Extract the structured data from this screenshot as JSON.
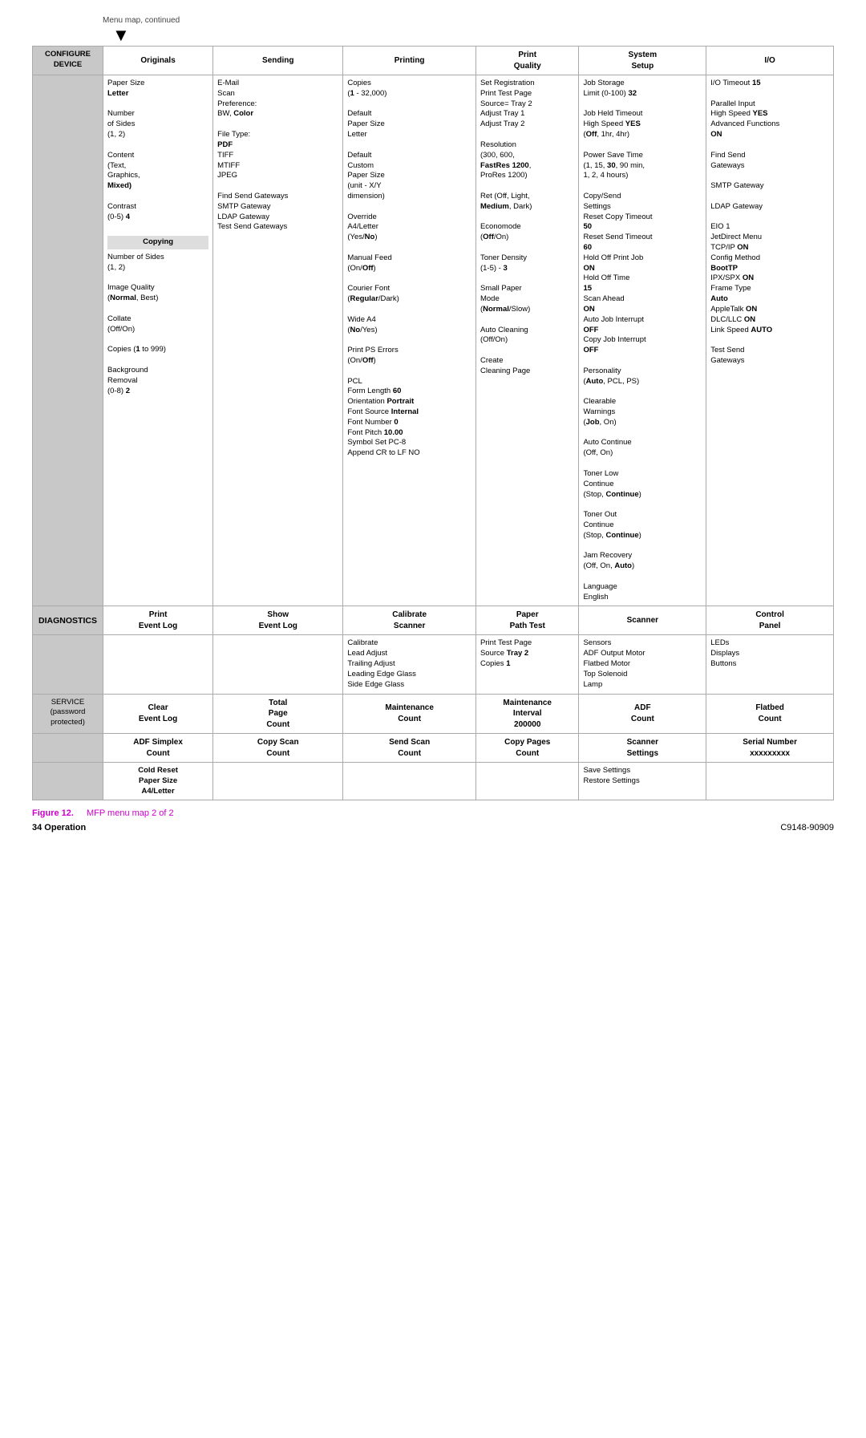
{
  "page": {
    "menu_continued": "Menu map, continued",
    "figure_label": "Figure 12.",
    "figure_title": "MFP menu map 2 of 2",
    "footer_left": "34  Operation",
    "footer_right": "C9148-90909"
  },
  "configure_device": {
    "label": "CONFIGURE\nDEVICE",
    "columns": {
      "originals": {
        "header": "Originals",
        "content_normal": [
          "Paper Size",
          "Number of Sides (1, 2)",
          "Content (Text, Graphics,",
          "Contrast (0-5)"
        ],
        "content_bold": [
          "Letter",
          "Mixed)",
          "4"
        ],
        "copying_header": "Copying",
        "copying_items": [
          "Number of Sides (1, 2)",
          "Image Quality",
          "Collate (Off/On)",
          "Copies",
          "Background Removal (0-8)"
        ],
        "copying_bold": [
          "(Normal, Best)",
          "1 to 999)",
          "2"
        ]
      },
      "sending": {
        "header": "Sending",
        "items": [
          "E-Mail Scan Preference: BW,",
          "File Type: PDF TIFF MTIFF JPEG",
          "Find Send Gateways SMTP Gateway LDAP Gateway Test Send Gateways"
        ],
        "bold_items": [
          "Color"
        ]
      },
      "printing": {
        "header": "Printing",
        "items": [
          "Copies (1 - 32,000)",
          "Print Test Page",
          "Source= Tray 2",
          "Adjust Tray 1",
          "Adjust Tray 2",
          "Default Paper Size Letter",
          "Default Custom Paper Size (unit - X/Y dimension)",
          "Override A4/Letter (Yes/No)",
          "Manual Feed (On/Off)",
          "Courier Font (Regular/Dark)",
          "Wide A4 (No/Yes)",
          "Print PS Errors (On/Off)",
          "PCL Form Length 60 Orientation Portrait Font Source Internal Font Number 0 Font Pitch 10.00 Symbol Set PC-8 Append CR to LF NO"
        ]
      },
      "print_quality": {
        "header": "Print\nQuality",
        "items": [
          "Set Registration Print Test Page Source= Tray 2 Adjust Tray 1 Adjust Tray 2",
          "Resolution (300, 600, FastRes 1200, ProRes 1200)",
          "Ret (Off, Light, Medium, Dark)",
          "Economode (Off/On)",
          "Toner Density (1-5) - 3",
          "Small Paper Mode (Normal/Slow)",
          "Auto Cleaning (Off/On)",
          "Create Cleaning Page"
        ]
      },
      "system_setup": {
        "header": "System\nSetup",
        "items": [
          "Job Storage Limit (0-100) 32",
          "Job Held Timeout (Off, 1hr, 4hr)",
          "Power Save Time (1, 15, 30, 90 min, 1, 2, 4 hours)",
          "Copy/Send Settings Reset Copy Timeout 50 Reset Send Timeout 60 Hold Off Print Job ON Hold Off Time 15 Scan Ahead ON Auto Job Interrupt OFF Copy Job Interrupt OFF",
          "Personality (Auto, PCL, PS)",
          "Clearable Warnings (Job, On)",
          "Auto Continue (Off, On)",
          "Toner Low Continue (Stop, Continue)",
          "Toner Out Continue (Stop, Continue)",
          "Jam Recovery (Off, On, Auto)",
          "Language English"
        ]
      },
      "io": {
        "header": "I/O",
        "items": [
          "I/O Timeout 15",
          "Parallel Input High Speed YES Advanced Functions ON",
          "Find Send Gateways",
          "SMTP Gateway",
          "LDAP Gateway",
          "EIO 1 JetDirect Menu TCP/IP ON Config Method BootTP IPX/SPX ON Frame Type Auto AppleTalk ON DLC/LLC ON Link Speed AUTO",
          "Test Send Gateways"
        ]
      }
    }
  },
  "diagnostics": {
    "label": "DIAGNOSTICS",
    "columns": {
      "print_event_log": {
        "header": "Print\nEvent Log"
      },
      "show_event_log": {
        "header": "Show\nEvent Log"
      },
      "calibrate_scanner": {
        "header": "Calibrate\nScanner",
        "items": [
          "Calibrate Lead Adjust Trailing Adjust Leading Edge Glass Side Edge Glass"
        ]
      },
      "paper_path_test": {
        "header": "Paper\nPath Test",
        "items": [
          "Print Test Page",
          "Source Tray 2",
          "Copies 1"
        ],
        "bold": [
          "Tray 2"
        ]
      },
      "scanner": {
        "header": "Scanner",
        "items": [
          "Sensors ADF Output Motor Flatbed Motor Top Solenoid Lamp"
        ]
      },
      "control_panel": {
        "header": "Control\nPanel",
        "items": [
          "LEDs Displays Buttons"
        ]
      }
    }
  },
  "service": {
    "label": "SERVICE\n(password\nprotected)",
    "row1": {
      "clear_event_log": "Clear\nEvent Log",
      "total_page_count": "Total\nPage\nCount",
      "maintenance_count": "Maintenance\nCount",
      "maintenance_interval": "Maintenance\nInterval\n200000",
      "adf_count": "ADF\nCount",
      "flatbed_count": "Flatbed\nCount"
    },
    "row2": {
      "adf_simplex_count": "ADF Simplex\nCount",
      "copy_scan_count": "Copy Scan\nCount",
      "send_scan_count": "Send Scan\nCount",
      "copy_pages_count": "Copy Pages\nCount",
      "scanner_settings": "Scanner\nSettings",
      "serial_number": "Serial Number\nxxxxxxxxx"
    },
    "row3": {
      "cold_reset": "Cold Reset\nPaper Size\nA4/Letter",
      "save_restore": "Save Settings\nRestore Settings"
    }
  }
}
